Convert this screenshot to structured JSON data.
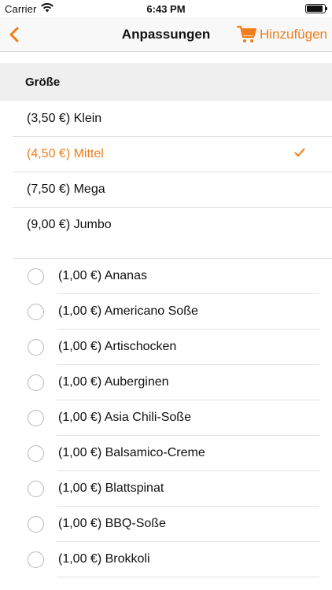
{
  "status_bar": {
    "carrier": "Carrier",
    "time": "6:43 PM"
  },
  "nav": {
    "back_icon": "chevron-left-icon",
    "title": "Anpassungen",
    "add_label": "Hinzufügen",
    "add_icon": "shopping-cart-icon",
    "accent_color": "#f07d1a"
  },
  "size_section": {
    "header": "Größe",
    "options": [
      {
        "label": "(3,50 €) Klein",
        "selected": false
      },
      {
        "label": "(4,50 €) Mittel",
        "selected": true
      },
      {
        "label": "(7,50 €) Mega",
        "selected": false
      },
      {
        "label": "(9,00 €) Jumbo",
        "selected": false
      }
    ]
  },
  "extras": [
    {
      "label": "(1,00 €) Ananas"
    },
    {
      "label": "(1,00 €) Americano Soße"
    },
    {
      "label": "(1,00 €) Artischocken"
    },
    {
      "label": "(1,00 €) Auberginen"
    },
    {
      "label": "(1,00 €) Asia Chili-Soße"
    },
    {
      "label": "(1,00 €) Balsamico-Creme"
    },
    {
      "label": "(1,00 €) Blattspinat"
    },
    {
      "label": "(1,00 €) BBQ-Soße"
    },
    {
      "label": "(1,00 €) Brokkoli"
    }
  ]
}
